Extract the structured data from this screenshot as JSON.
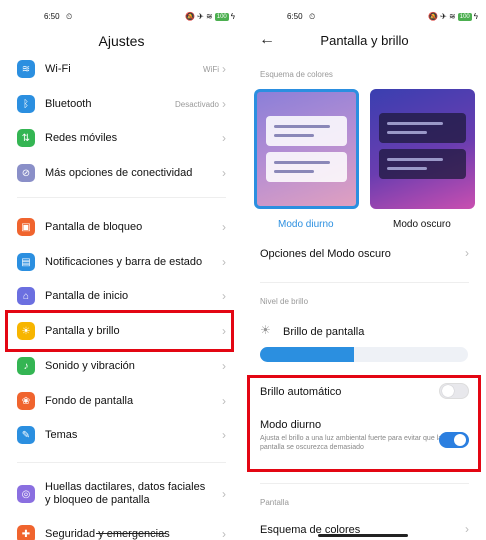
{
  "left": {
    "status": {
      "time": "6:50",
      "alarm": "⏲",
      "icons": "🔕 ✈ ≋",
      "battery": "100",
      "bolt": "ϟ"
    },
    "title": "Ajustes",
    "items": [
      {
        "label": "Wi-Fi",
        "value": "WiFi",
        "icon": "wifi-icon",
        "glyph": "≋",
        "color": "#2b8fe0"
      },
      {
        "label": "Bluetooth",
        "value": "Desactivado",
        "icon": "bluetooth-icon",
        "glyph": "ᛒ",
        "color": "#2b8fe0"
      },
      {
        "label": "Redes móviles",
        "value": "",
        "icon": "mobile-network-icon",
        "glyph": "⇅",
        "color": "#34b553"
      },
      {
        "label": "Más opciones de conectividad",
        "value": "",
        "icon": "connectivity-icon",
        "glyph": "⊘",
        "color": "#8a8fc8"
      },
      {
        "label": "Pantalla de bloqueo",
        "value": "",
        "icon": "lock-icon",
        "glyph": "▣",
        "color": "#f0642e"
      },
      {
        "label": "Notificaciones y barra de estado",
        "value": "",
        "icon": "notifications-icon",
        "glyph": "▤",
        "color": "#2b8fe0"
      },
      {
        "label": "Pantalla de inicio",
        "value": "",
        "icon": "home-icon",
        "glyph": "⌂",
        "color": "#6b6fe0"
      },
      {
        "label": "Pantalla y brillo",
        "value": "",
        "icon": "brightness-icon",
        "glyph": "☀",
        "color": "#f7b500"
      },
      {
        "label": "Sonido y vibración",
        "value": "",
        "icon": "sound-icon",
        "glyph": "♪",
        "color": "#34b553"
      },
      {
        "label": "Fondo de pantalla",
        "value": "",
        "icon": "wallpaper-icon",
        "glyph": "❀",
        "color": "#f0642e"
      },
      {
        "label": "Temas",
        "value": "",
        "icon": "themes-icon",
        "glyph": "✎",
        "color": "#2b8fe0"
      },
      {
        "label": "Huellas dactilares, datos faciales\ny bloqueo de pantalla",
        "value": "",
        "icon": "fingerprint-icon",
        "glyph": "◎",
        "color": "#8a6fe0"
      },
      {
        "label": "Seguridad y emergencias",
        "value": "",
        "icon": "security-icon",
        "glyph": "✚",
        "color": "#f0642e"
      }
    ],
    "chevron": "›"
  },
  "right": {
    "status": {
      "time": "6:50",
      "alarm": "⏲",
      "icons": "🔕 ✈ ≋",
      "battery": "100",
      "bolt": "ϟ"
    },
    "back": "←",
    "title": "Pantalla y brillo",
    "color_scheme_section": "Esquema de colores",
    "mode_light": "Modo diurno",
    "mode_dark": "Modo oscuro",
    "dark_options": "Opciones del Modo oscuro",
    "brightness_section": "Nivel de brillo",
    "brightness_label": "Brillo de pantalla",
    "brightness_level": 0.45,
    "auto_brightness": "Brillo automático",
    "auto_brightness_on": false,
    "day_mode": "Modo diurno",
    "day_mode_desc": "Ajusta el brillo a una luz ambiental fuerte para evitar que la pantalla se oscurezca demasiado",
    "day_mode_on": true,
    "screen_section": "Pantalla",
    "color_scheme_row": "Esquema de colores",
    "chevron": "›"
  },
  "colors": {
    "accent": "#2b8fe0",
    "highlight": "#e30613"
  }
}
